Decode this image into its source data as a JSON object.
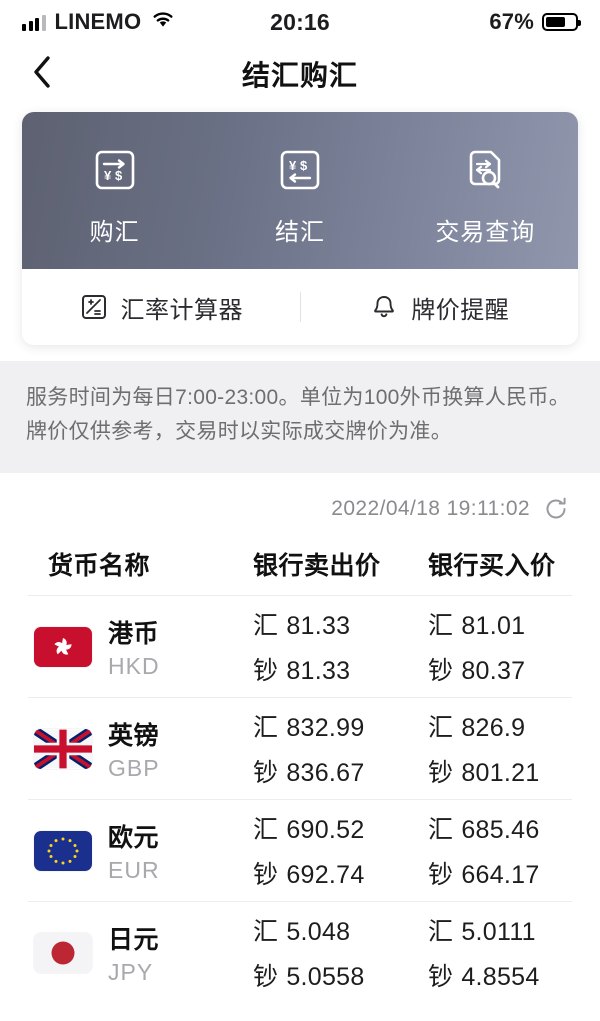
{
  "status_bar": {
    "carrier": "LINEMO",
    "time": "20:16",
    "battery_percent": "67%",
    "signal_icon": "signal-bars-icon",
    "wifi_icon": "wifi-icon",
    "battery_icon": "battery-icon"
  },
  "nav": {
    "title": "结汇购汇",
    "back_icon": "chevron-left-icon"
  },
  "actions": [
    {
      "label": "购汇",
      "icon": "buy-foreign-currency-icon"
    },
    {
      "label": "结汇",
      "icon": "settle-foreign-currency-icon"
    },
    {
      "label": "交易查询",
      "icon": "transaction-query-icon"
    }
  ],
  "links": [
    {
      "label": "汇率计算器",
      "icon": "calculator-icon"
    },
    {
      "label": "牌价提醒",
      "icon": "bell-icon"
    }
  ],
  "notice": {
    "line1": "服务时间为每日7:00-23:00。单位为100外币换算人民币。",
    "line2": "牌价仅供参考，交易时以实际成交牌价为准。"
  },
  "timestamp": {
    "value": "2022/04/18 19:11:02",
    "refresh_icon": "refresh-icon"
  },
  "table": {
    "headers": {
      "currency": "货币名称",
      "sell": "银行卖出价",
      "buy": "银行买入价"
    },
    "labels": {
      "wire": "汇",
      "cash": "钞"
    },
    "rows": [
      {
        "name": "港币",
        "code": "HKD",
        "flag": "hong-kong-flag",
        "sell_wire": "81.33",
        "sell_cash": "81.33",
        "buy_wire": "81.01",
        "buy_cash": "80.37"
      },
      {
        "name": "英镑",
        "code": "GBP",
        "flag": "united-kingdom-flag",
        "sell_wire": "832.99",
        "sell_cash": "836.67",
        "buy_wire": "826.9",
        "buy_cash": "801.21"
      },
      {
        "name": "欧元",
        "code": "EUR",
        "flag": "european-union-flag",
        "sell_wire": "690.52",
        "sell_cash": "692.74",
        "buy_wire": "685.46",
        "buy_cash": "664.17"
      },
      {
        "name": "日元",
        "code": "JPY",
        "flag": "japan-flag",
        "sell_wire": "5.048",
        "sell_cash": "5.0558",
        "buy_wire": "5.0111",
        "buy_cash": "4.8554"
      }
    ]
  },
  "colors": {
    "card_gradient_start": "#5d6171",
    "card_gradient_end": "#9096ac",
    "notice_bg": "#f0f0f2",
    "muted_text": "#a8a8ad"
  }
}
